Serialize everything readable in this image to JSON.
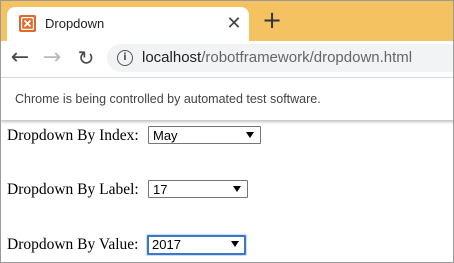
{
  "browser": {
    "tab": {
      "title": "Dropdown",
      "close": "✕"
    },
    "new_tab": "+",
    "nav": {
      "back": "←",
      "forward": "→",
      "reload": "↻"
    },
    "address": {
      "info": "i",
      "host": "localhost",
      "path": "/robotframework/dropdown.html"
    },
    "infobar": "Chrome is being controlled by automated test software."
  },
  "form": {
    "rows": [
      {
        "label": "Dropdown By Index:",
        "value": "May"
      },
      {
        "label": "Dropdown By Label:",
        "value": "17"
      },
      {
        "label": "Dropdown By Value:",
        "value": "2017"
      }
    ]
  }
}
